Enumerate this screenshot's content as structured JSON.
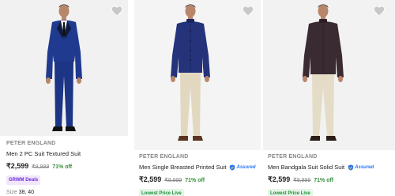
{
  "products": [
    {
      "brand": "PETER ENGLAND",
      "title": "Men 2 PC Suit Textured Suit",
      "price": "₹2,599",
      "mrp": "₹8,999",
      "discount": "71% off",
      "badge": "GRWM Deals",
      "size_label": "Size",
      "size_values": "38, 40",
      "assured": false,
      "icon": "heart-icon",
      "image_colors": {
        "jacket": "#1f3a8f",
        "pants": "#1c3584",
        "shirt": "#ffffff",
        "tie": "#111111",
        "shoes": "#111111"
      }
    },
    {
      "brand": "PETER ENGLAND",
      "title": "Men Single Breasted Printed Suit",
      "price": "₹2,599",
      "mrp": "₹8,999",
      "discount": "71% off",
      "badge": "Lowest Price Live",
      "assured": true,
      "assured_label": "Assured",
      "icon": "heart-icon",
      "image_colors": {
        "jacket": "#24337a",
        "pants": "#e2d8bf",
        "shoes": "#5a3420"
      }
    },
    {
      "brand": "PETER ENGLAND",
      "title": "Men Bandgala Suit Solid Suit",
      "price": "₹2,599",
      "mrp": "₹8,999",
      "discount": "71% off",
      "badge": "Lowest Price Live",
      "assured": true,
      "assured_label": "Assured",
      "icon": "heart-icon",
      "image_colors": {
        "jacket": "#3a2b33",
        "pants": "#e4dcc6",
        "shoes": "#2a1d16"
      }
    }
  ]
}
